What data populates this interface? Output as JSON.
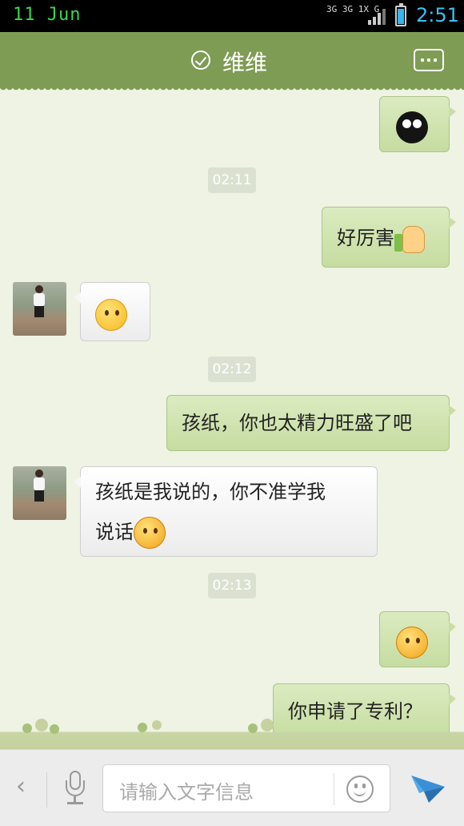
{
  "status_bar": {
    "date": "11 Jun",
    "network": "3G 3G 1X G",
    "clock": "2:51"
  },
  "header": {
    "contact_name": "维维",
    "verified_icon": "check-circle-icon",
    "more_icon": "more-dots-icon"
  },
  "messages": [
    {
      "type": "out",
      "emoji": "black-crying-face"
    },
    {
      "type": "timestamp",
      "text": "02:11"
    },
    {
      "type": "out",
      "text": "好厉害",
      "emoji": "thumbs-up"
    },
    {
      "type": "in",
      "emoji": "sad-face"
    },
    {
      "type": "timestamp",
      "text": "02:12"
    },
    {
      "type": "out",
      "text": "孩纸，你也太精力旺盛了吧"
    },
    {
      "type": "in",
      "text_line1": "孩纸是我说的，你不准学我",
      "text_line2": "说话",
      "emoji": "angry-face"
    },
    {
      "type": "timestamp",
      "text": "02:13"
    },
    {
      "type": "out",
      "emoji": "nose-picking-face"
    },
    {
      "type": "out",
      "text": "你申请了专利？"
    }
  ],
  "input_bar": {
    "placeholder": "请输入文字信息",
    "back_icon": "chevron-left-icon",
    "mic_icon": "microphone-icon",
    "emoji_icon": "smiley-icon",
    "send_icon": "send-icon"
  },
  "colors": {
    "header": "#7f9c54",
    "outgoing_bubble": "#c6dca1",
    "incoming_bubble": "#ffffff",
    "chat_background": "#eef3e4",
    "clock": "#3ac2f4"
  }
}
